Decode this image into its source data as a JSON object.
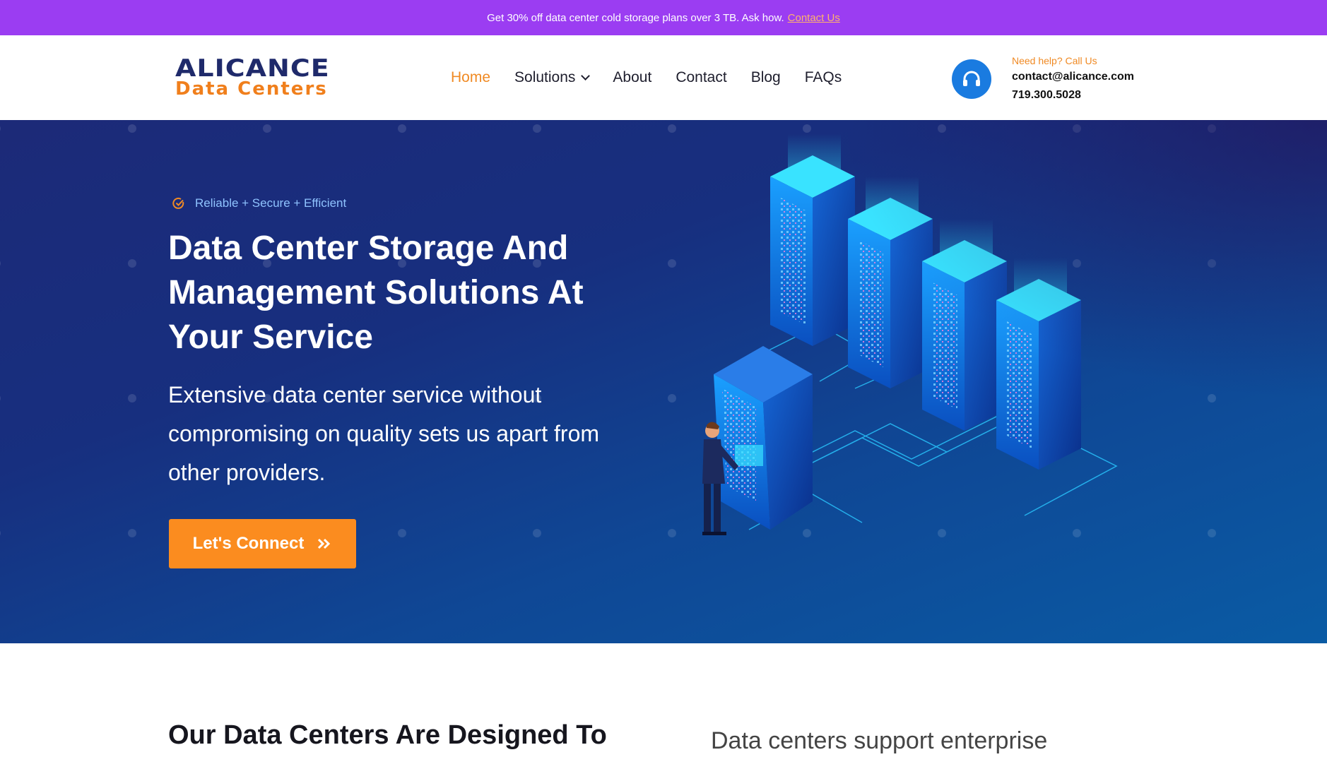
{
  "promo": {
    "text": "Get 30% off data center cold storage plans over 3 TB. Ask how.",
    "link_label": "Contact Us"
  },
  "header": {
    "logo": {
      "line1": "ALICANCE",
      "line2": "Data Centers"
    },
    "nav": [
      {
        "label": "Home",
        "active": true
      },
      {
        "label": "Solutions",
        "has_dropdown": true
      },
      {
        "label": "About"
      },
      {
        "label": "Contact"
      },
      {
        "label": "Blog"
      },
      {
        "label": "FAQs"
      }
    ],
    "help": {
      "icon": "headphones-icon",
      "title": "Need help? Call Us",
      "email": "contact@alicance.com",
      "phone": "719.300.5028"
    }
  },
  "hero": {
    "tagline": "Reliable + Secure + Efficient",
    "title": "Data Center Storage And Management Solutions At Your Service",
    "subtitle": "Extensive data center service without compromising on quality sets us apart from other providers.",
    "cta_label": "Let's Connect"
  },
  "below": {
    "left_heading": "Our Data Centers Are Designed To",
    "right_text": "Data centers support enterprise"
  },
  "colors": {
    "promo_bg": "#9b3df2",
    "accent_orange": "#fb8c1f",
    "hero_bg_start": "#1c2a78",
    "hero_bg_end": "#0a5ba4",
    "brand_navy": "#1f2a6b",
    "help_icon_bg": "#1a7be0"
  }
}
